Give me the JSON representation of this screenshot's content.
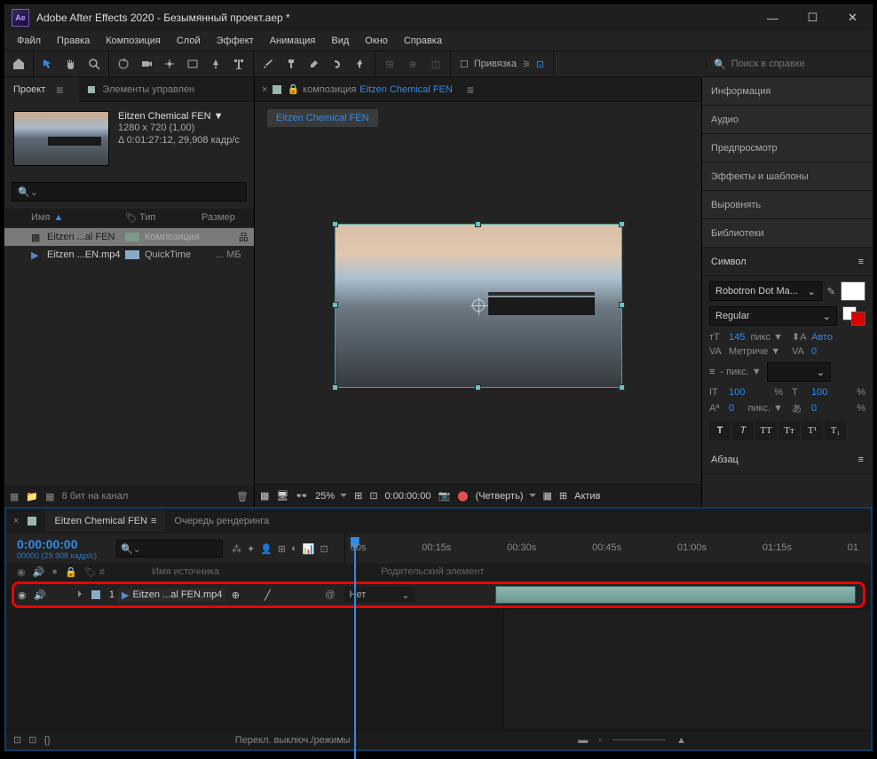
{
  "titlebar": {
    "app_icon": "Ae",
    "title": "Adobe After Effects 2020 - Безымянный проект.aep *"
  },
  "menu": [
    "Файл",
    "Правка",
    "Композиция",
    "Слой",
    "Эффект",
    "Анимация",
    "Вид",
    "Окно",
    "Справка"
  ],
  "toolbar": {
    "snap_label": "Привязка"
  },
  "search": {
    "placeholder": "Поиск в справке"
  },
  "project": {
    "tab_project": "Проект",
    "tab_controls": "Элементы управлен",
    "comp_name": "Eitzen Chemical FEN ▼",
    "comp_dims": "1280 x 720 (1,00)",
    "comp_dur": "Δ 0:01:27:12, 29,908 кадр/с",
    "col_name": "Имя",
    "col_type": "Тип",
    "col_size": "Размер",
    "rows": [
      {
        "name": "Eitzen ...al FEN",
        "type": "Композиция",
        "size": ""
      },
      {
        "name": "Eitzen ...EN.mp4",
        "type": "QuickTime",
        "size": "... МБ"
      }
    ],
    "bits": "8 бит на канал"
  },
  "viewer": {
    "pre": "композиция",
    "comp": "Eitzen Chemical FEN",
    "layer_chip": "Eitzen Chemical FEN",
    "zoom": "25%",
    "timecode": "0:00:00:00",
    "res": "(Четверть)",
    "active": "Актив"
  },
  "right": {
    "sections": [
      "Информация",
      "Аудио",
      "Предпросмотр",
      "Эффекты и шаблоны",
      "Выровнять",
      "Библиотеки"
    ],
    "char_title": "Символ",
    "font": "Robotron Dot Ma...",
    "style": "Regular",
    "size": "145",
    "size_unit": "пикс ▼",
    "leading": "Авто",
    "kerning": "Метриче ▼",
    "tracking": "0",
    "stroke_w": "- пикс. ▼",
    "vscale": "100",
    "hscale": "100",
    "scale_unit": "%",
    "baseline": "0",
    "baseline_unit": "пикс. ▼",
    "tsume": "0",
    "tsume_unit": "%",
    "para_title": "Абзац"
  },
  "timeline": {
    "tab": "Eitzen Chemical FEN",
    "queue": "Очередь рендеринга",
    "tc": "0:00:00:00",
    "tc_sub": "00000 (29.908 кадр/с)",
    "marks": [
      "00s",
      "00:15s",
      "00:30s",
      "00:45s",
      "01:00s",
      "01:15s",
      "01"
    ],
    "col_src": "Имя источника",
    "col_parent": "Родительский элемент",
    "layer_num": "1",
    "layer_name": "Eitzen ...al FEN.mp4",
    "parent_none": "Нет",
    "footer_msg": "Перекл. выключ./режимы"
  }
}
